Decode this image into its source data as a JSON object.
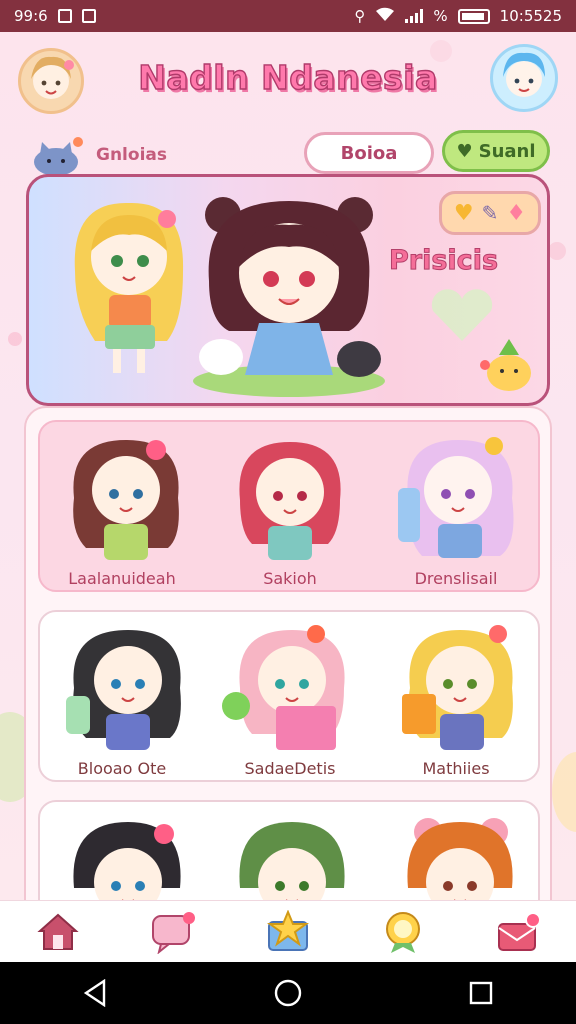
{
  "status_bar": {
    "time": "99:6",
    "right_text": "10:5525",
    "battery": "%"
  },
  "app": {
    "title_part1": "Nadln",
    "title_part2": "Ndanesia",
    "subtitle": "Gnloias",
    "search_placeholder": "Boioa",
    "action_button": "Suanl"
  },
  "hero": {
    "label": "Prisicis"
  },
  "characters": [
    {
      "name": "Laalanuideah"
    },
    {
      "name": "Sakioh"
    },
    {
      "name": "Drenslisail"
    },
    {
      "name": "Blooao Ote"
    },
    {
      "name": "SadaeDetis"
    },
    {
      "name": "Mathiies"
    }
  ],
  "colors": {
    "status_bar": "#83313f",
    "accent_pink": "#f56e99",
    "accent_green": "#bfe87f"
  },
  "bottom_nav": [
    {
      "icon": "home-icon"
    },
    {
      "icon": "chat-icon"
    },
    {
      "icon": "star-icon"
    },
    {
      "icon": "medal-icon"
    },
    {
      "icon": "gift-icon"
    }
  ]
}
